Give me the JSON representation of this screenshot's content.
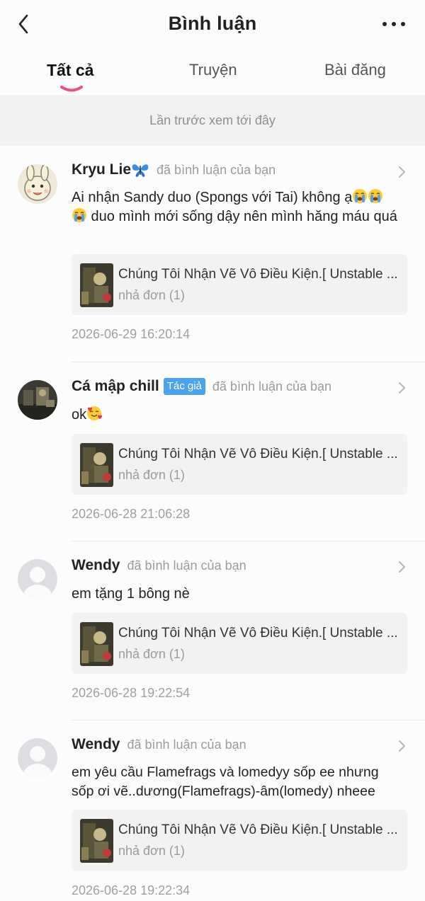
{
  "header": {
    "title": "Bình luận",
    "back_icon": "chevron-left-icon",
    "more_icon": "more-horizontal-icon"
  },
  "tabs": [
    {
      "label": "Tất cả",
      "active": true
    },
    {
      "label": "Truyện",
      "active": false
    },
    {
      "label": "Bài đăng",
      "active": false
    }
  ],
  "notice": "Lần trước xem tới đây",
  "colors": {
    "accent": "#ee4f7c",
    "badge": "#4aa3ec"
  },
  "comments": [
    {
      "user": "Kryu Lie",
      "user_emoji": "butterfly",
      "badge": "",
      "action": "đã bình luận của bạn",
      "text_parts": [
        "Ai nhận Sandy duo (Spongs với Tai) không ạ",
        " duo mình mới sống dậy nên mình hăng máu quá"
      ],
      "ref_title": "Chúng Tôi Nhận Vẽ Vô Điều Kiện.[ Unstable ...",
      "ref_sub": "nhả đơn (1)",
      "time": "2026-06-29 16:20:14"
    },
    {
      "user": "Cá mập chill",
      "badge": "Tác giả",
      "action": "đã bình luận của bạn",
      "text": "ok",
      "ref_title": "Chúng Tôi Nhận Vẽ Vô Điều Kiện.[ Unstable ...",
      "ref_sub": "nhả đơn (1)",
      "time": "2026-06-28 21:06:28"
    },
    {
      "user": "Wendy",
      "badge": "",
      "action": "đã bình luận của bạn",
      "text": "em tặng 1 bông nè",
      "ref_title": "Chúng Tôi Nhận Vẽ Vô Điều Kiện.[ Unstable ...",
      "ref_sub": "nhả đơn (1)",
      "time": "2026-06-28 19:22:54"
    },
    {
      "user": "Wendy",
      "badge": "",
      "action": "đã bình luận của bạn",
      "text": "em yêu cầu Flamefrags và lomedyy sốp ee nhưng sốp ơi vẽ..dương(Flamefrags)-âm(lomedy) nheee",
      "ref_title": "Chúng Tôi Nhận Vẽ Vô Điều Kiện.[ Unstable ...",
      "ref_sub": "nhả đơn (1)",
      "time": "2026-06-28 19:22:34"
    }
  ]
}
